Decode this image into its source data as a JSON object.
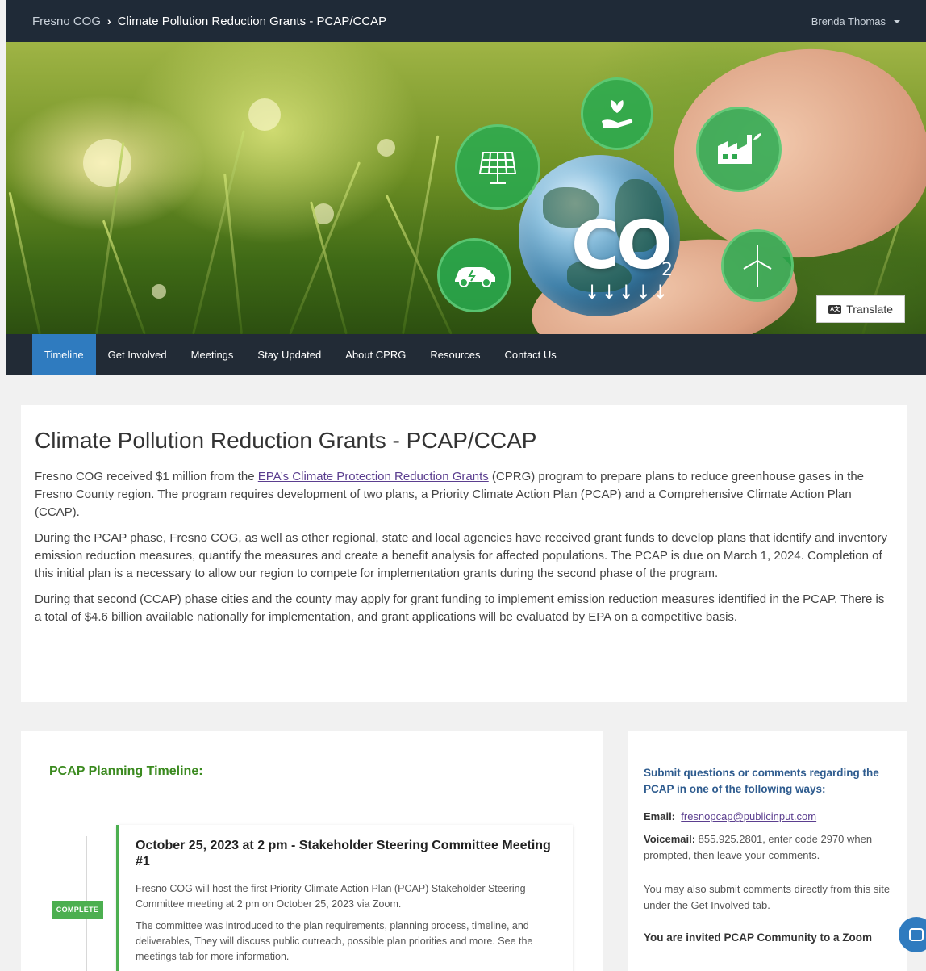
{
  "header": {
    "org": "Fresno COG",
    "separator": "›",
    "page": "Climate Pollution Reduction Grants - PCAP/CCAP",
    "user": "Brenda Thomas"
  },
  "hero": {
    "co2_text": "CO",
    "co2_subscript": "2",
    "arrows": "↓↓↓↓↓",
    "translate_label": "Translate",
    "translate_icon_text": "A文"
  },
  "nav": {
    "items": [
      "Timeline",
      "Get Involved",
      "Meetings",
      "Stay Updated",
      "About CPRG",
      "Resources",
      "Contact Us"
    ],
    "active": "Timeline"
  },
  "intro": {
    "title": "Climate Pollution Reduction Grants - PCAP/CCAP",
    "p1_before": "Fresno COG received $1 million from the ",
    "p1_link": "EPA’s Climate Protection Reduction Grants",
    "p1_after": " (CPRG) program to prepare plans to reduce greenhouse gases in the Fresno County region. The program requires development of two plans, a Priority Climate Action Plan (PCAP) and a Comprehensive Climate Action Plan (CCAP).",
    "p2": "During the PCAP phase, Fresno COG, as well as other regional, state and local agencies have received grant funds to develop plans that identify and inventory emission reduction measures, quantify the measures and create a benefit analysis for affected populations. The PCAP is due on March 1, 2024. Completion of this initial plan is a necessary to allow our region to compete for implementation grants during the second phase of the program.",
    "p3": "During that second (CCAP) phase cities and the county may apply for grant funding to implement emission reduction measures identified in the PCAP. There is a total of $4.6 billion available nationally for implementation, and grant applications will be evaluated by EPA on a competitive basis."
  },
  "timeline": {
    "title": "PCAP Planning Timeline:",
    "status_badge": "COMPLETE",
    "event_title": "October 25, 2023 at 2 pm - Stakeholder Steering Committee Meeting #1",
    "event_p1": "Fresno COG will host the first Priority Climate Action Plan (PCAP) Stakeholder Steering Committee meeting at 2 pm on October 25, 2023 via Zoom.",
    "event_p2": "The committee was introduced to the plan requirements, planning process, timeline, and deliverables,  They will discuss public outreach, possible plan priorities and more. See the meetings tab for more information."
  },
  "sidebar": {
    "heading": "Submit questions or comments regarding the PCAP in one of the following ways:",
    "email_label": "Email:",
    "email": "fresnopcap@publicinput.com",
    "voicemail_label": "Voicemail:",
    "voicemail_text": " 855.925.2801, enter code 2970 when prompted, then leave your comments.",
    "direct_text": "You may also submit comments directly from this site under the Get Involved tab.",
    "invite_text": "You are invited PCAP Community to a Zoom"
  },
  "colors": {
    "header_bg": "#1f2a37",
    "nav_bg": "#222b36",
    "nav_active": "#2f7bbf",
    "timeline_green": "#3b8a1f",
    "badge_green": "#4caf50",
    "sidebar_heading": "#2f5c8f",
    "link": "#5b3e8f"
  },
  "icons": [
    "chevron-right-icon",
    "caret-down-icon",
    "translate-icon",
    "solar-panel-icon",
    "plant-hand-icon",
    "factory-icon",
    "electric-car-icon",
    "wind-turbine-icon",
    "chat-icon"
  ]
}
